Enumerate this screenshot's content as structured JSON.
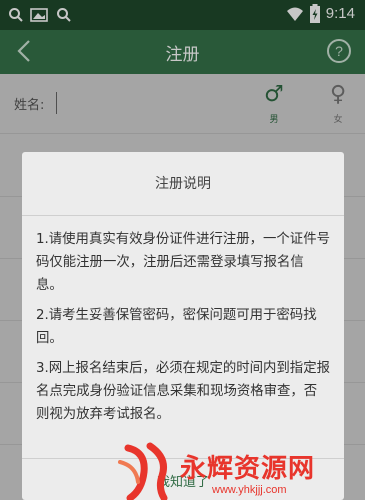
{
  "status_bar": {
    "icons": [
      "search-icon",
      "image-icon",
      "search-icon",
      "wifi-icon",
      "battery-icon"
    ],
    "time": "9:14"
  },
  "app_bar": {
    "title": "注册",
    "back_icon": "chevron-left-icon",
    "help_icon": "question-circle-icon",
    "help_symbol": "?"
  },
  "form": {
    "name_label": "姓名:",
    "name_value": "",
    "gender_male": {
      "symbol": "♂",
      "label": "男"
    },
    "gender_female": {
      "symbol": "♀",
      "label": "女"
    }
  },
  "dialog": {
    "title": "注册说明",
    "paragraphs": [
      "1.请使用真实有效身份证件进行注册，一个证件号码仅能注册一次，注册后还需登录填写报名信息。",
      "2.请考生妥善保管密码，密保问题可用于密码找回。",
      "3.网上报名结束后，必须在规定的时间内到指定报名点完成身份验证信息采集和现场资格审查，否则视为放弃考试报名。"
    ],
    "confirm_label": "我知道了"
  },
  "watermark": {
    "text": "永辉资源网",
    "url": "www.yhkjjj.com"
  },
  "colors": {
    "app_bar": "#35734a",
    "status_bar": "#1f4a2c",
    "watermark": "#e8352c"
  }
}
